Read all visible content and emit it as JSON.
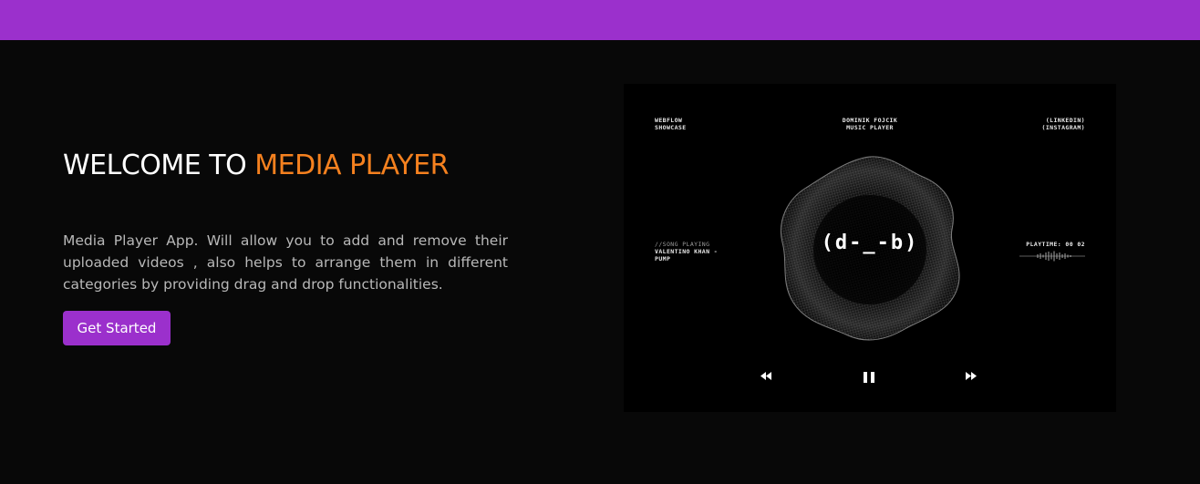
{
  "colors": {
    "brand": "#9b30cc",
    "accent": "#f5811f",
    "background": "#080808"
  },
  "hero": {
    "title_prefix": "WELCOME TO",
    "title_accent": "MEDIA PLAYER",
    "description": "Media Player App. Will allow you to add and remove their uploaded videos , also helps to arrange them in different categories by providing drag and drop functionalities.",
    "cta_label": "Get Started"
  },
  "player": {
    "top_left": [
      "WEBFLOW",
      "SHOWCASE"
    ],
    "top_center": [
      "DOMINIK FOJCIK",
      "MUSIC PLAYER"
    ],
    "top_right": [
      "(LINKEDIN)",
      "(INSTAGRAM)"
    ],
    "now_playing_label": "//SONG PLAYING",
    "song_lines": [
      "VALENTINO KHAN -",
      "PUMP"
    ],
    "playtime": "PLAYTIME: 00 02",
    "logo_text": "(d-_-b)",
    "icons": {
      "prev": "rewind-icon",
      "pause": "pause-icon",
      "next": "fast-forward-icon"
    }
  }
}
